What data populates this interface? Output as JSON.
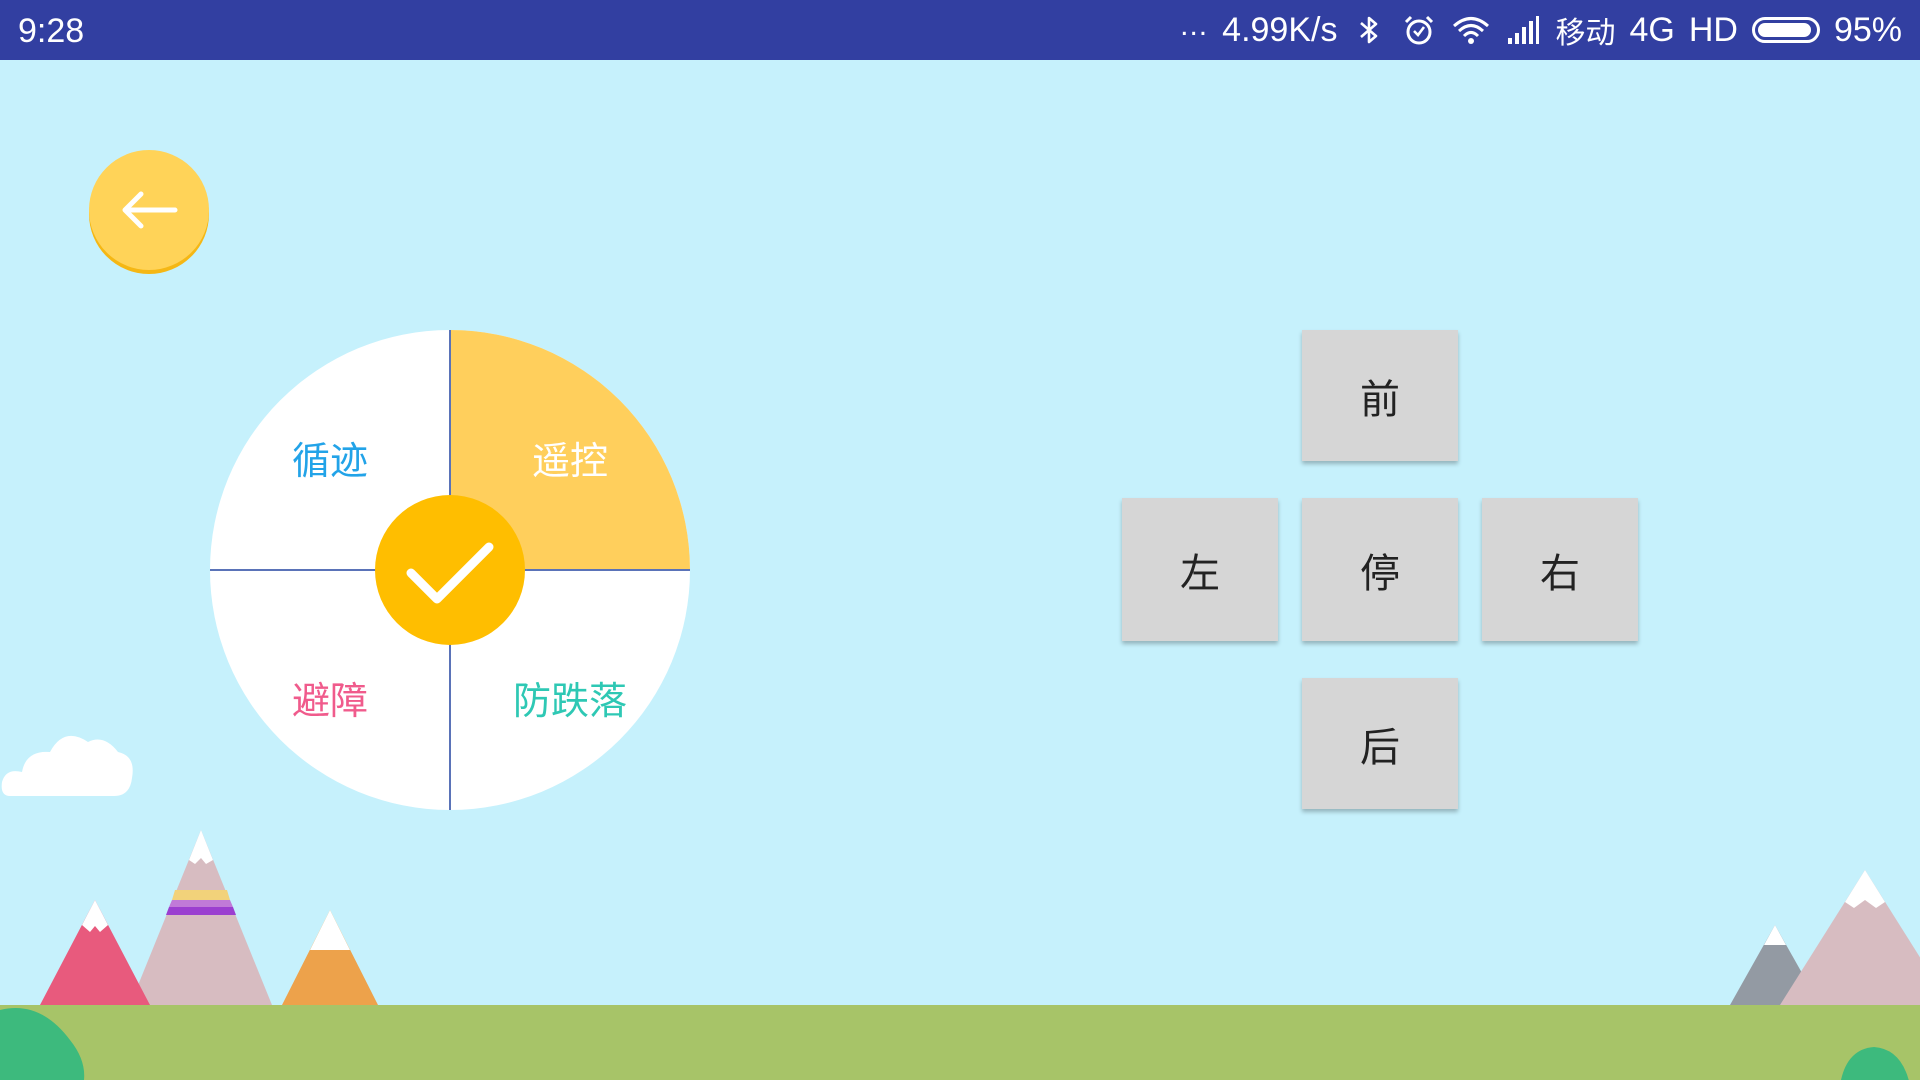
{
  "status_bar": {
    "time": "9:28",
    "dots": "...",
    "net_speed": "4.99K/s",
    "carrier": "移动",
    "network": "4G",
    "hd": "HD",
    "battery": "95%",
    "battery_level": 0.95,
    "icons": [
      "bluetooth-icon",
      "alarm-icon",
      "wifi-icon",
      "signal-icon",
      "battery-icon"
    ]
  },
  "back_button": {
    "icon": "arrow-left-icon"
  },
  "modes": {
    "items": [
      {
        "label": "循迹",
        "color": "#22a3e8"
      },
      {
        "label": "遥控",
        "color": "#ffffff",
        "selected": true
      },
      {
        "label": "避障",
        "color": "#f05b8c"
      },
      {
        "label": "防跌落",
        "color": "#2ec8b4"
      }
    ],
    "selected_color": "#ffcf5c",
    "confirm_icon": "checkmark-icon"
  },
  "direction_pad": {
    "forward": "前",
    "left": "左",
    "stop": "停",
    "right": "右",
    "backward": "后"
  },
  "colors": {
    "status_bar": "#323fa1",
    "background": "#c6f1fc",
    "accent": "#ffbe00",
    "button": "#d6d6d6",
    "ground": "#a7c468"
  }
}
